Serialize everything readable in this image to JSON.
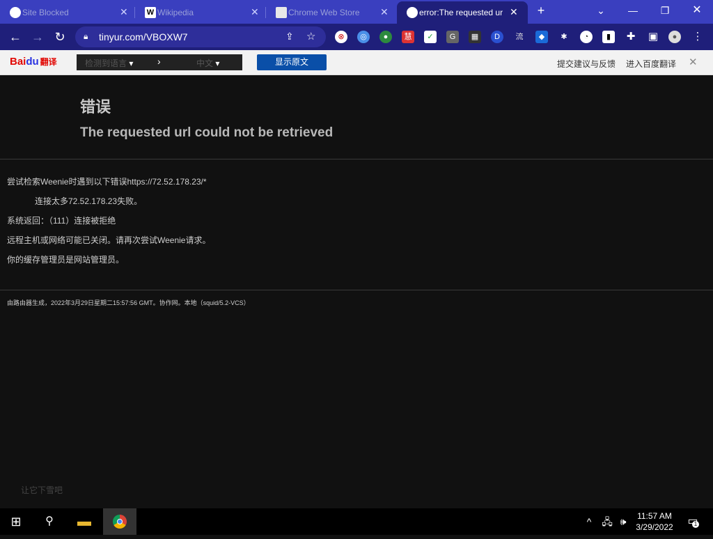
{
  "tabs": [
    {
      "title": "Site Blocked",
      "active": false
    },
    {
      "title": "Wikipedia",
      "active": false
    },
    {
      "title": "Chrome Web Store",
      "active": false
    },
    {
      "title": "error:The requested url",
      "active": true
    }
  ],
  "new_tab_label": "+",
  "omnibox": {
    "url": "tinyur.com/VBOXW7"
  },
  "baidu_bar": {
    "logo_bai": "Bai",
    "logo_du": "du",
    "logo_fanyi": "翻译",
    "source_lang": "检测到语言",
    "target_lang": "中文",
    "show_original": "显示原文",
    "feedback": "提交建议与反馈",
    "enter_baidu": "进入百度翻译"
  },
  "page": {
    "title": "错误",
    "subtitle": "The requested url could not be retrieved",
    "lines": [
      "尝试检索Weenie时遇到以下错误https://72.52.178.23/*",
      "连接太多72.52.178.23失败。",
      "系统返回：（111）连接被拒绝",
      "远程主机或网络可能已关闭。请再次尝试Weenie请求。",
      "你的缓存管理员是网站管理员。"
    ],
    "footer": "由路由器生成，2022年3月29日星期二15:57:56 GMT。协作网。本地（squid/5.2-VCS）",
    "corner_text": "让它下雪吧"
  },
  "taskbar": {
    "time": "11:57 AM",
    "date": "3/29/2022",
    "notification_count": "1"
  }
}
